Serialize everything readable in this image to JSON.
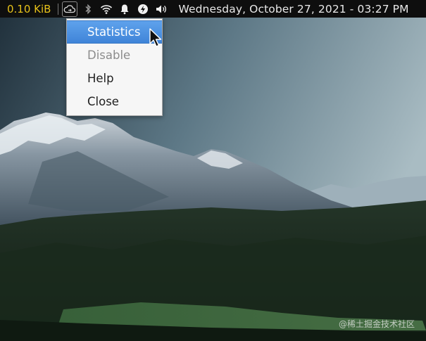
{
  "panel": {
    "net_speed": "0.10 KiB",
    "clock": "Wednesday, October 27, 2021 - 03:27 PM",
    "tray_icons": [
      "cloud-sync-icon",
      "bluetooth-icon",
      "wifi-icon",
      "bell-icon",
      "power-icon",
      "volume-icon"
    ]
  },
  "menu": {
    "items": [
      {
        "label": "Statistics",
        "state": "selected"
      },
      {
        "label": "Disable",
        "state": "disabled"
      },
      {
        "label": "Help",
        "state": "normal"
      },
      {
        "label": "Close",
        "state": "normal"
      }
    ]
  },
  "watermark": "@稀土掘金技术社区",
  "colors": {
    "panel_bg": "#0e0e0e",
    "net_speed": "#e6c11a",
    "menu_highlight": "#4a90e2",
    "menu_bg": "#f6f6f6"
  }
}
